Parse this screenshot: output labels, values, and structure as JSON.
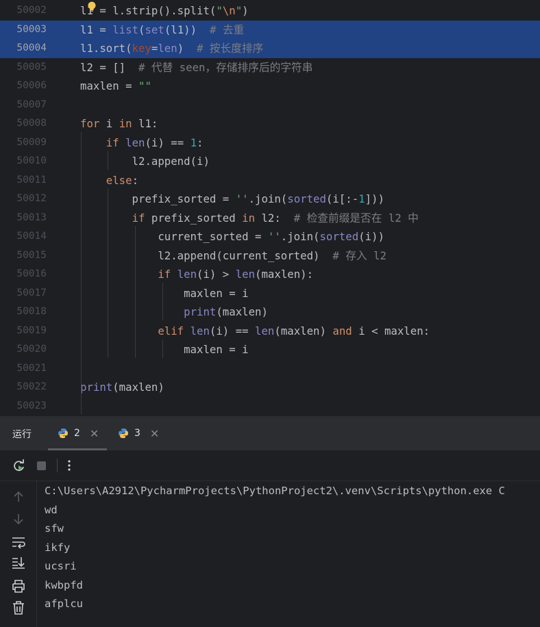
{
  "editor": {
    "lines": [
      {
        "num": "50002",
        "code": "l1 = l.strip().split(\"\\n\")"
      },
      {
        "num": "50003",
        "code": "l1 = list(set(l1))  # 去重"
      },
      {
        "num": "50004",
        "code": "l1.sort(key=len)  # 按长度排序"
      },
      {
        "num": "50005",
        "code": "l2 = []  # 代替 seen，存储排序后的字符串"
      },
      {
        "num": "50006",
        "code": "maxlen = \"\""
      },
      {
        "num": "50007",
        "code": ""
      },
      {
        "num": "50008",
        "code": "for i in l1:"
      },
      {
        "num": "50009",
        "code": "    if len(i) == 1:"
      },
      {
        "num": "50010",
        "code": "        l2.append(i)"
      },
      {
        "num": "50011",
        "code": "    else:"
      },
      {
        "num": "50012",
        "code": "        prefix_sorted = ''.join(sorted(i[:-1]))"
      },
      {
        "num": "50013",
        "code": "        if prefix_sorted in l2:  # 检查前缀是否在 l2 中"
      },
      {
        "num": "50014",
        "code": "            current_sorted = ''.join(sorted(i))"
      },
      {
        "num": "50015",
        "code": "            l2.append(current_sorted)  # 存入 l2"
      },
      {
        "num": "50016",
        "code": "            if len(i) > len(maxlen):"
      },
      {
        "num": "50017",
        "code": "                maxlen = i"
      },
      {
        "num": "50018",
        "code": "                print(maxlen)"
      },
      {
        "num": "50019",
        "code": "            elif len(i) == len(maxlen) and i < maxlen:"
      },
      {
        "num": "50020",
        "code": "                maxlen = i"
      },
      {
        "num": "50021",
        "code": ""
      },
      {
        "num": "50022",
        "code": "print(maxlen)"
      },
      {
        "num": "50023",
        "code": ""
      }
    ],
    "selected_lines": [
      "50003",
      "50004"
    ],
    "intention_icon": "lightbulb-icon"
  },
  "run_panel": {
    "title": "运行",
    "tabs": [
      {
        "label": "2",
        "icon": "python-icon",
        "active": true
      },
      {
        "label": "3",
        "icon": "python-icon",
        "active": false
      }
    ],
    "toolbar": [
      "rerun-icon",
      "stop-icon",
      "more-options-icon"
    ],
    "side_tools": [
      "scroll-up-icon",
      "scroll-down-icon",
      "soft-wrap-icon",
      "scroll-to-end-icon",
      "print-icon",
      "clear-all-icon"
    ],
    "console_lines": [
      "C:\\Users\\A2912\\PycharmProjects\\PythonProject2\\.venv\\Scripts\\python.exe C",
      "wd",
      "sfw",
      "ikfy",
      "ucsri",
      "kwbpfd",
      "afplcu"
    ]
  },
  "colors": {
    "background": "#1e1f22",
    "selection": "#214283",
    "keyword": "#cf8e6d",
    "builtin": "#8888c6",
    "string": "#6aab73",
    "number": "#2aacb8",
    "comment": "#7a7e85",
    "param": "#aa4926",
    "text": "#bcbec4"
  }
}
